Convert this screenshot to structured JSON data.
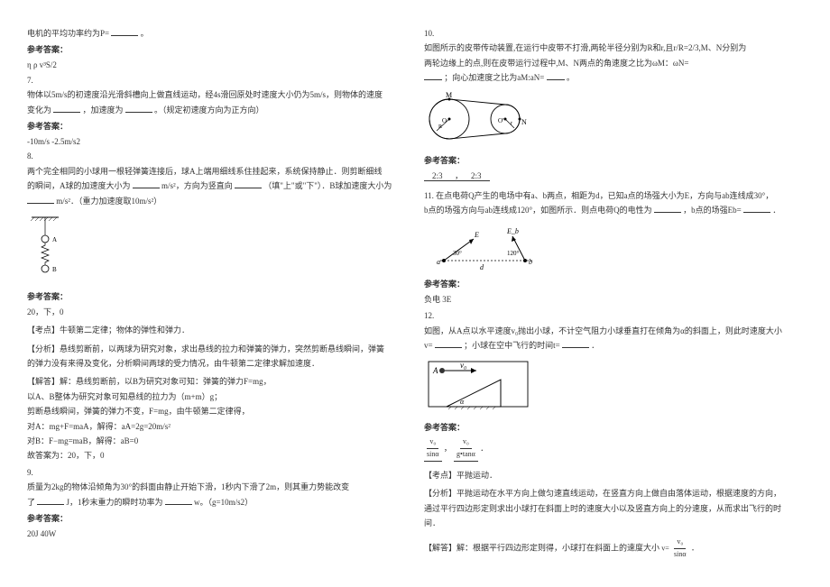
{
  "left": {
    "p1": "电机的平均功率约为P=",
    "p1_end": "。",
    "ans_label": "参考答案：",
    "a1": "η ρ v³S/2",
    "q7_num": "7.",
    "q7_1": "物体以5m/s的初速度沿光滑斜槽向上做直线运动，经4s滑回原处时速度大小仍为5m/s，则物体的速度",
    "q7_2": "变化为",
    "q7_3": "，加速度为",
    "q7_4": "。（规定初速度方向为正方向）",
    "a7": "-10m/s  -2.5m/s2",
    "q8_num": "8.",
    "q8_1": "两个完全相同的小球用一根轻弹簧连接后，球A上端用细线系住挂起来，系统保持静止．则剪断细线",
    "q8_2": "的瞬间，A球的加速度大小为",
    "q8_2b": "m/s²，方向为竖直向",
    "q8_2c": "（填\"上\"或\"下\"）．B球加速度大小为",
    "q8_3": "m/s²．（重力加速度取10m/s²）",
    "a8": "20，下，0",
    "a8_k1": "【考点】牛顿第二定律；物体的弹性和弹力．",
    "a8_k2": "【分析】悬线剪断前，以两球为研究对象，求出悬线的拉力和弹簧的弹力，突然剪断悬线瞬间，弹簧",
    "a8_k3": "的弹力没有来得及变化，分析瞬间两球的受力情况，由牛顿第二定律求解加速度．",
    "a8_s1": "【解答】解：悬线剪断前，以B为研究对象可知：弹簧的弹力F=mg，",
    "a8_s2": "以A、B整体为研究对象可知悬线的拉力为（m+m）g；",
    "a8_s3": "剪断悬线瞬间，弹簧的弹力不变，F=mg，由牛顿第二定律得，",
    "a8_s4": "对A：mg+F=maA，解得：aA=2g=20m/s²",
    "a8_s5": "对B：F−mg=maB，解得：aB=0",
    "a8_s6": "故答案为：20，下，0",
    "q9_num": "9.",
    "q9_1": "质量为2kg的物体沿倾角为30°的斜面由静止开始下滑，1秒内下滑了2m，则其重力势能改变",
    "q9_2": "了",
    "q9_2b": "J，1秒末重力的瞬时功率为",
    "q9_2c": "w。（g=10m/s2）",
    "a9": "20J    40W"
  },
  "right": {
    "q10_num": "10.",
    "q10_1": "如图所示的皮带传动装置,在运行中皮带不打滑,两轮半径分别为R和r,且r/R=2/3,M、N分别为",
    "q10_2": "两轮边缘上的点,则在皮带运行过程中,M、N两点的角速度之比为ωM：ωN=",
    "q10_3": "；向心加速度之比为aM:aN=",
    "q10_3b": "。",
    "ans_label": "参考答案：",
    "a10": "    2:3      ，    2:3    ",
    "q11_1": "11. 在点电荷Q产生的电场中有a、b两点，相距为d，已知a点的场强大小为E，方向与ab连线成30°，",
    "q11_2": "b点的场强方向与ab连线成120°，如图所示．则点电荷Q的电性为",
    "q11_2b": "，b点的场强Eb=",
    "q11_2c": "．",
    "a11": "负电  3E",
    "q12_num": "12.",
    "q12_1": "如图，从A点以水平速度v₀抛出小球，不计空气阻力小球垂直打在倾角为α的斜面上，则此时速度大小",
    "q12_2": "v=",
    "q12_2b": "；小球在空中飞行的时间t=",
    "q12_2c": "．",
    "a12_l": {
      "n": "v₀",
      "d": "sinα"
    },
    "a12_sep": "，",
    "a12_r": {
      "n": "v₀",
      "d": "g•tanα"
    },
    "a12_end": "．",
    "k12": "【考点】平抛运动．",
    "f12_1": "【分析】平抛运动在水平方向上做匀速直线运动，在竖直方向上做自由落体运动，根据速度的方向，",
    "f12_2": "通过平行四边形定则求出小球打在斜面上时的速度大小以及竖直方向上的分速度，从而求出飞行的时",
    "f12_3": "间．",
    "s12_1": "【解答】解：根据平行四边形定则得，小球打在斜面上的速度大小",
    "s12_frac": {
      "n": "v₀",
      "d": "sinα"
    },
    "s12_2": "．"
  }
}
